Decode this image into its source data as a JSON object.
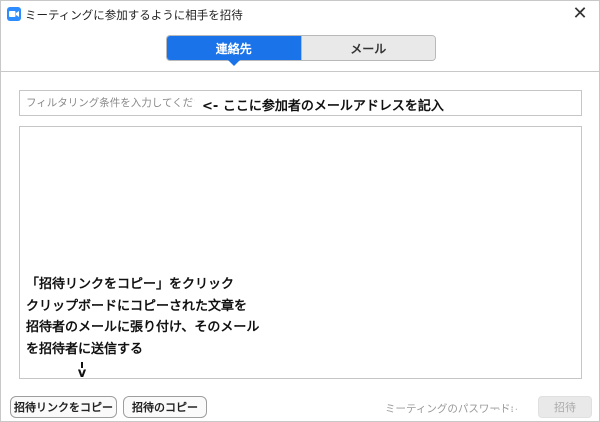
{
  "window": {
    "title": "ミーティングに参加するように相手を招待",
    "close_glyph": "✕"
  },
  "tabs": [
    {
      "label": "連絡先",
      "active": true
    },
    {
      "label": "メール",
      "active": false
    }
  ],
  "filter": {
    "placeholder": "フィルタリング条件を入力してください",
    "annotation": "<- ここに参加者のメールアドレスを記入"
  },
  "list": {
    "annotation_lines": [
      "「招待リンクをコピー」をクリック",
      "クリップボードにコピーされた文章を",
      "招待者のメールに張り付け、そのメール",
      "を招待者に送信する"
    ],
    "annotation_arrow": "v"
  },
  "footer": {
    "copy_link_label": "招待リンクをコピー",
    "copy_invite_label": "招待のコピー",
    "password_label": "ミーティングのパスワード:",
    "password_value": "......",
    "invite_label": "招待"
  },
  "colors": {
    "accent": "#1a73e8",
    "app_icon": "#2d8cff"
  }
}
